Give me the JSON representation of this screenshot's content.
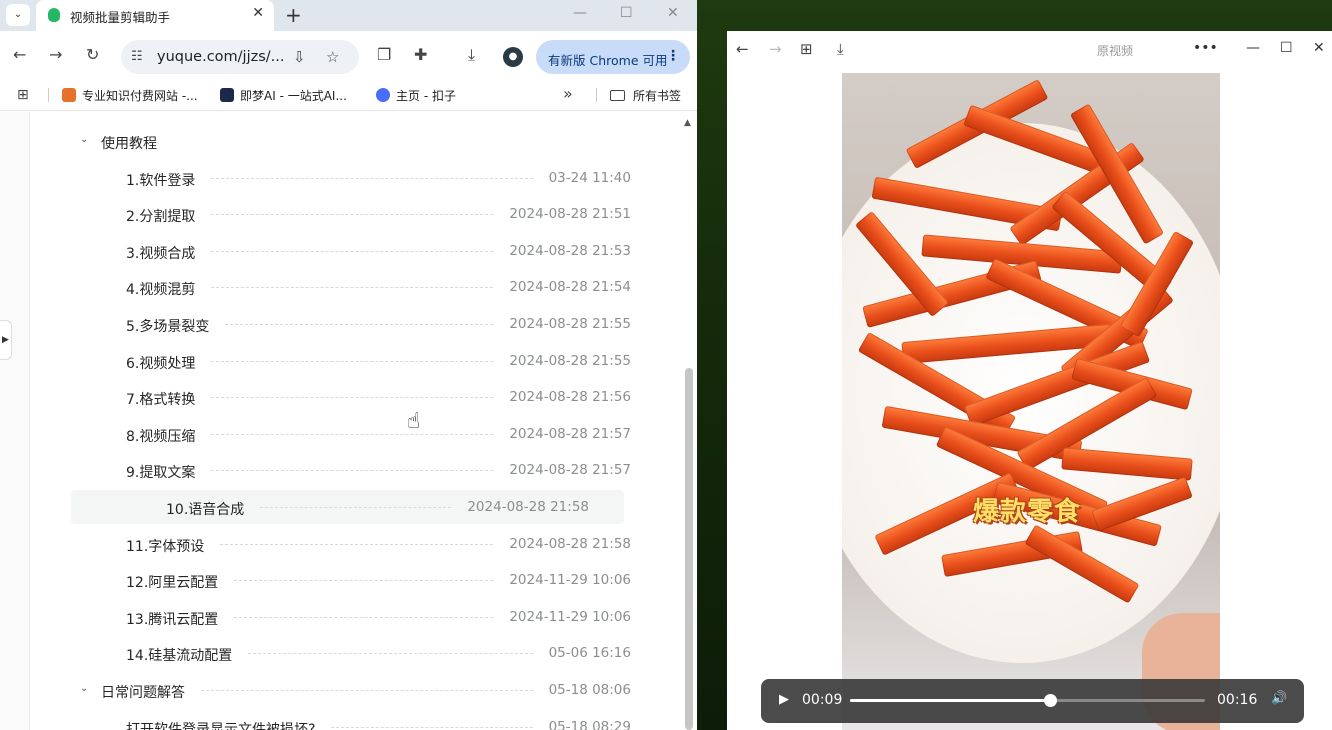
{
  "browser": {
    "tab_menu_icon": "chevron-down",
    "tab_title": "视频批量剪辑助手",
    "tab_close": "✕",
    "new_tab": "+",
    "window": {
      "minimize": "—",
      "maximize": "☐",
      "close": "✕"
    },
    "url": "yuque.com/jjzs/...",
    "update_button": "有新版 Chrome 可用",
    "bookmarks": [
      {
        "label": "专业知识付费网站 -...",
        "color": "#e6712a"
      },
      {
        "label": "即梦AI - 一站式AI...",
        "color": "#1b2a4a"
      },
      {
        "label": "主页 - 扣子",
        "color": "#4a6cf7"
      }
    ],
    "bookmarks_more": "»",
    "all_bookmarks": "所有书签"
  },
  "doc": {
    "rows": [
      {
        "kind": "section",
        "title": "使用教程",
        "date": ""
      },
      {
        "kind": "item",
        "title": "1.软件登录",
        "date": "03-24 11:40"
      },
      {
        "kind": "item",
        "title": "2.分割提取",
        "date": "2024-08-28 21:51"
      },
      {
        "kind": "item",
        "title": "3.视频合成",
        "date": "2024-08-28 21:53"
      },
      {
        "kind": "item",
        "title": "4.视频混剪",
        "date": "2024-08-28 21:54"
      },
      {
        "kind": "item",
        "title": "5.多场景裂变",
        "date": "2024-08-28 21:55"
      },
      {
        "kind": "item",
        "title": "6.视频处理",
        "date": "2024-08-28 21:55"
      },
      {
        "kind": "item",
        "title": "7.格式转换",
        "date": "2024-08-28 21:56"
      },
      {
        "kind": "item",
        "title": "8.视频压缩",
        "date": "2024-08-28 21:57"
      },
      {
        "kind": "item",
        "title": "9.提取文案",
        "date": "2024-08-28 21:57"
      },
      {
        "kind": "item",
        "title": "10.语音合成",
        "date": "2024-08-28 21:58",
        "active": true
      },
      {
        "kind": "item",
        "title": "11.字体预设",
        "date": "2024-08-28 21:58"
      },
      {
        "kind": "item",
        "title": "12.阿里云配置",
        "date": "2024-11-29 10:06"
      },
      {
        "kind": "item",
        "title": "13.腾讯云配置",
        "date": "2024-11-29 10:06"
      },
      {
        "kind": "item",
        "title": "14.硅基流动配置",
        "date": "05-06 16:16"
      },
      {
        "kind": "section",
        "title": "日常问题解答",
        "date": "05-18 08:06"
      },
      {
        "kind": "item",
        "title": "打开软件登录显示文件被损坏?",
        "date": "05-18 08:29"
      }
    ]
  },
  "viewer": {
    "title": "原视频",
    "caption": "爆款零食",
    "current_time": "00:09",
    "total_time": "00:16",
    "progress": 0.5625
  },
  "colors": {
    "accent": "#c8dcfa",
    "active_row": "#f4f5f5",
    "date_gray": "#8a8f8d"
  }
}
